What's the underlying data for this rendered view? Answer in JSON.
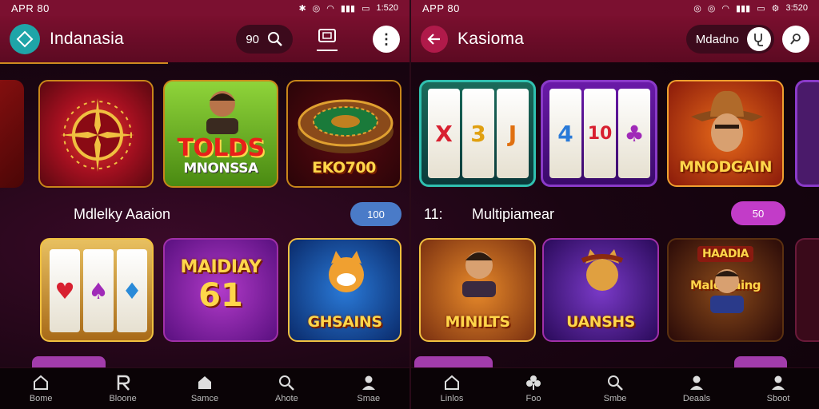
{
  "left": {
    "status": {
      "time": "APR 80",
      "clock": "1:520"
    },
    "appbar": {
      "title": "Indanasia",
      "search_value": "90"
    },
    "tiles_row1": [
      {
        "label": ""
      },
      {
        "label": "TOLDS MNONSSA",
        "label_a": "TOLDS",
        "label_b": "MNONSSA"
      },
      {
        "label": "EKO700"
      }
    ],
    "section": {
      "title": "Mdlelky Aaaion",
      "count": "100"
    },
    "tiles_row2": [
      {
        "label": ""
      },
      {
        "label_a": "MAIDIAY",
        "label_b": "61"
      },
      {
        "label": "GHSAINS"
      }
    ],
    "nav": [
      {
        "label": "Bome",
        "icon": "home-icon"
      },
      {
        "label": "Bloone",
        "icon": "r-icon"
      },
      {
        "label": "Samce",
        "icon": "home-icon"
      },
      {
        "label": "Ahote",
        "icon": "search-icon"
      },
      {
        "label": "Smae",
        "icon": "user-icon"
      }
    ]
  },
  "right": {
    "status": {
      "time": "APP 80",
      "clock": "3:520"
    },
    "appbar": {
      "title": "Kasioma",
      "search_value": "Mdadno"
    },
    "tiles_row1": [
      {
        "label": ""
      },
      {
        "label": ""
      },
      {
        "label": "MNODGAIN"
      }
    ],
    "section": {
      "prefix": "11:",
      "title": "Multipiamear",
      "count": "50"
    },
    "tiles_row2": [
      {
        "label": "MINILTS"
      },
      {
        "label": "UANSHS"
      },
      {
        "label_a": "HAADIA",
        "label_b": "Malonjaing"
      }
    ],
    "nav": [
      {
        "label": "Linlos",
        "icon": "home-icon"
      },
      {
        "label": "Foo",
        "icon": "clover-icon"
      },
      {
        "label": "Smbe",
        "icon": "search-icon"
      },
      {
        "label": "Deaals",
        "icon": "user-icon"
      },
      {
        "label": "Sboot",
        "icon": "user-icon"
      }
    ]
  },
  "colors": {
    "appbar": "#6a0d28",
    "accent_teal": "#1fa5a8",
    "accent_purple": "#c23cc8",
    "pill_blue": "#4a7bc8"
  }
}
